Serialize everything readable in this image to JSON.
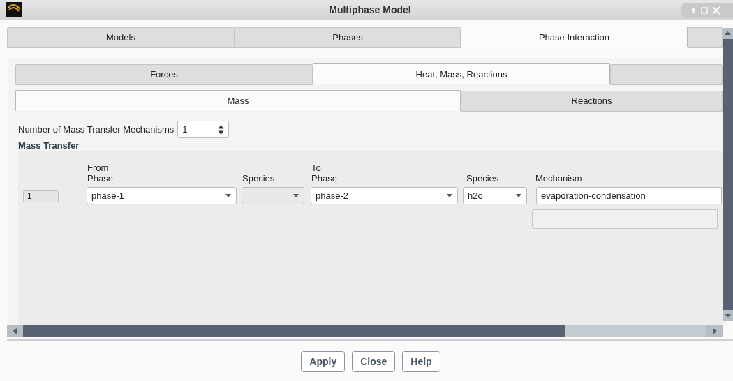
{
  "window": {
    "title": "Multiphase Model"
  },
  "tabs": [
    {
      "label": "Models",
      "selected": false
    },
    {
      "label": "Phases",
      "selected": false
    },
    {
      "label": "Phase Interaction",
      "selected": true
    },
    {
      "selected": false
    }
  ],
  "subtabs": [
    {
      "label": "Forces",
      "selected": false
    },
    {
      "label": "Heat, Mass, Reactions",
      "selected": true
    },
    {
      "selected": false
    }
  ],
  "inner_tabs": [
    {
      "label": "Mass",
      "selected": true
    },
    {
      "label": "Reactions",
      "selected": false
    }
  ],
  "mechanisms_count": {
    "label": "Number of Mass Transfer Mechanisms",
    "value": "1"
  },
  "section_title": "Mass Transfer",
  "table": {
    "columns": [
      {
        "line1": "From",
        "line2": "Phase"
      },
      {
        "line2": "Species"
      },
      {
        "line1": "To",
        "line2": "Phase"
      },
      {
        "line2": "Species"
      },
      {
        "line2": "Mechanism"
      }
    ],
    "rows": [
      {
        "index": "1",
        "from_phase": "phase-1",
        "to_phase": "phase-2",
        "to_species": "h2o",
        "mechanism": "evaporation-condensation"
      }
    ]
  },
  "buttons": [
    "Apply",
    "Close",
    "Help"
  ]
}
